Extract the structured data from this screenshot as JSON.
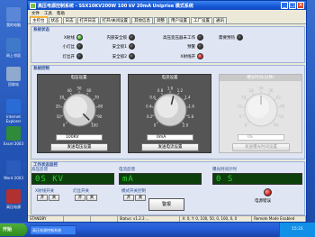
{
  "desktop": {
    "icons": [
      {
        "label": "我的电脑",
        "color": "#5a87d8"
      },
      {
        "label": "网上邻居",
        "color": "#3f79c9"
      },
      {
        "label": "回收站",
        "color": "#8fa9cf"
      },
      {
        "label": "Internet Explorer",
        "color": "#2a6cd6"
      },
      {
        "label": "Excel 2003",
        "color": "#2f8a3a"
      },
      {
        "label": "Word 2003",
        "color": "#2a5bbd"
      },
      {
        "label": "高压电源",
        "color": "#b23030"
      }
    ]
  },
  "window": {
    "title": "高压电源控制系统 - SSX10KV200W 100 kV 20mA Uniprise 模式系统",
    "buttons": {
      "min": "_",
      "max": "□",
      "close": "×"
    }
  },
  "menu": [
    "文件",
    "工具",
    "帮助"
  ],
  "tabs": [
    "主控台",
    "状态",
    "日志",
    "打开日志",
    "打开/关闭设置",
    "其他信息",
    "调整",
    "用户设置",
    "工厂设置",
    "通讯"
  ],
  "active_tab": 0,
  "status_section": {
    "label": "系统状态",
    "indicators": [
      {
        "label": "X射线",
        "state": "green"
      },
      {
        "label": "内部安全锁",
        "state": "dark"
      },
      {
        "label": "高压变压器未工作",
        "state": "dark"
      },
      {
        "label": "需要预热",
        "state": "dark"
      },
      {
        "label": "小灯丝",
        "state": "dark"
      },
      {
        "label": "安全锁1",
        "state": "dark"
      },
      {
        "label": "预警",
        "state": "dark"
      },
      {
        "label": "灯丝开",
        "state": "dark"
      },
      {
        "label": "安全锁2",
        "state": "dark"
      },
      {
        "label": "X射线开",
        "state": "red"
      }
    ]
  },
  "control_section": {
    "label": "系统控制",
    "knobs": [
      {
        "title": "电压设置",
        "value": "100KV",
        "button": "发送电压设置",
        "ticks": [
          "0",
          "10",
          "20",
          "30",
          "40",
          "50",
          "60",
          "70",
          "80",
          "90",
          "100"
        ],
        "enabled": true,
        "level": 1.0
      },
      {
        "title": "电流设置",
        "value": "0mA",
        "button": "发送电流设置",
        "ticks": [
          "0",
          "0.2",
          "0.4",
          "0.6",
          "0.8",
          "1.0",
          "1.2",
          "1.4",
          "1.6",
          "1.8",
          "2.0"
        ],
        "enabled": true,
        "level": 0.55
      },
      {
        "title": "曝光时间(分钟)",
        "value": "0S",
        "button": "发送曝光时间设置",
        "ticks": [
          "0",
          "6",
          "12",
          "18",
          "24",
          "30",
          "36",
          "42",
          "48",
          "54",
          "60"
        ],
        "enabled": false,
        "level": 0.5
      }
    ]
  },
  "monitor": {
    "label": "工作状态监控",
    "voltage": {
      "label": "高压反馈",
      "value": "0S  KV"
    },
    "current": {
      "label": "电流反馈",
      "value": "mA"
    },
    "exposure": {
      "label": "曝光时间计时",
      "value": "0  S"
    },
    "switches": [
      {
        "label": "X射线开关",
        "on": "开",
        "off": "关"
      },
      {
        "label": "灯丝开关",
        "on": "开",
        "off": "关"
      },
      {
        "label": "模式开关控制",
        "on": "开",
        "off": "关"
      }
    ],
    "warn_button": "警报",
    "power_error": "电源错误"
  },
  "statusbar": [
    "STANDBY",
    "",
    "",
    "Status: v1.2.3 ...",
    "X: 0, Y: 0, 100, 50, 0, 100, 0, 0",
    "Remote Mode Enabled"
  ],
  "taskbar": {
    "start": "开始",
    "item": "高压电源控制系统",
    "clock": "15:21"
  }
}
